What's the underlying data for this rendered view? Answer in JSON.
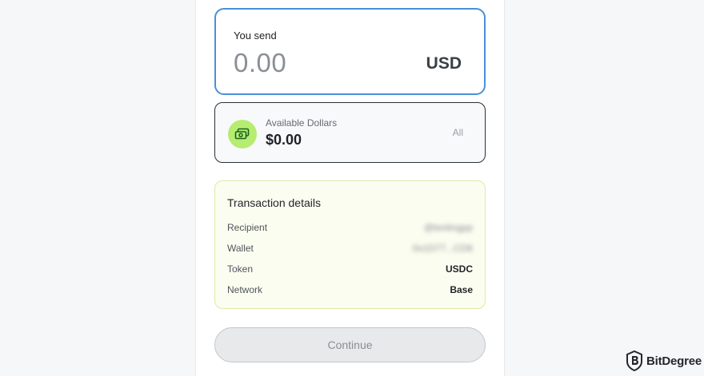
{
  "send": {
    "label": "You send",
    "amount": "0.00",
    "currency": "USD"
  },
  "available": {
    "label": "Available Dollars",
    "amount": "$0.00",
    "all_label": "All",
    "icon": "cash-icon"
  },
  "transaction": {
    "title": "Transaction details",
    "rows": [
      {
        "key": "Recipient",
        "value": "@testingpp"
      },
      {
        "key": "Wallet",
        "value": "0x1D77...CD6"
      },
      {
        "key": "Token",
        "value": "USDC"
      },
      {
        "key": "Network",
        "value": "Base"
      }
    ]
  },
  "continue_label": "Continue",
  "watermark": {
    "text": "BitDegree",
    "icon": "bitdegree-logo-icon"
  },
  "colors": {
    "accent_border": "#4a8fd8",
    "cash_icon_bg": "#b6ec70",
    "details_bg": "#fbfdf0",
    "details_border": "#dfe9a6"
  }
}
